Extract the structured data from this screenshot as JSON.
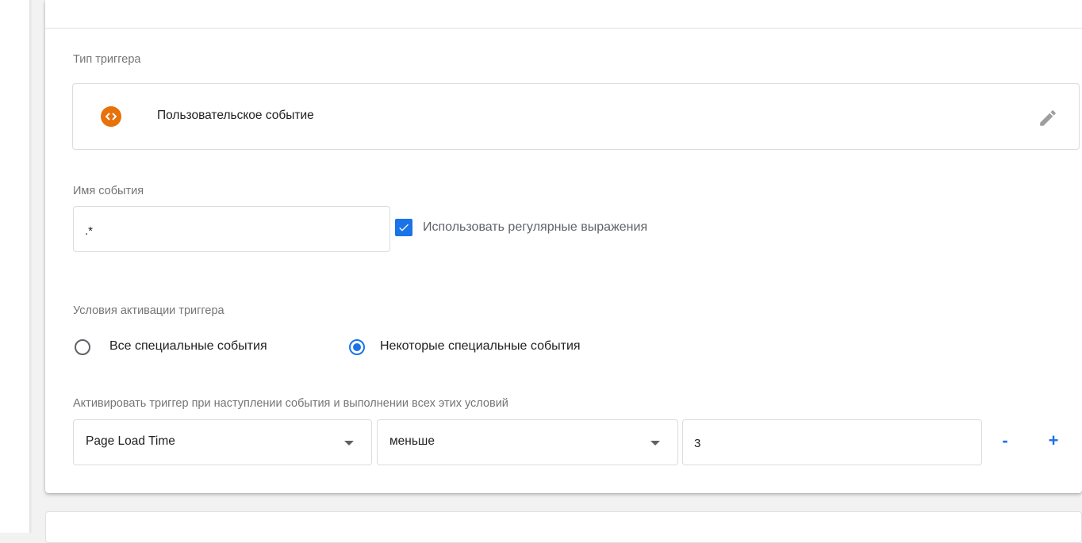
{
  "trigger_type": {
    "label": "Тип триггера",
    "name": "Пользовательское событие",
    "icon": "custom-event-icon",
    "icon_color": "#e8710a"
  },
  "event_name": {
    "label": "Имя события",
    "value": ".*",
    "use_regex_label": "Использовать регулярные выражения",
    "use_regex_checked": true
  },
  "activation": {
    "label": "Условия активации триггера",
    "options": [
      {
        "label": "Все специальные события",
        "selected": false
      },
      {
        "label": "Некоторые специальные события",
        "selected": true
      }
    ]
  },
  "conditions": {
    "label": "Активировать триггер при наступлении события и выполнении всех этих условий",
    "rows": [
      {
        "variable": "Page Load Time",
        "operator": "меньше",
        "value": "3"
      }
    ],
    "remove_label": "-",
    "add_label": "+"
  },
  "colors": {
    "accent": "#1a73e8",
    "tag_orange": "#e8710a"
  }
}
